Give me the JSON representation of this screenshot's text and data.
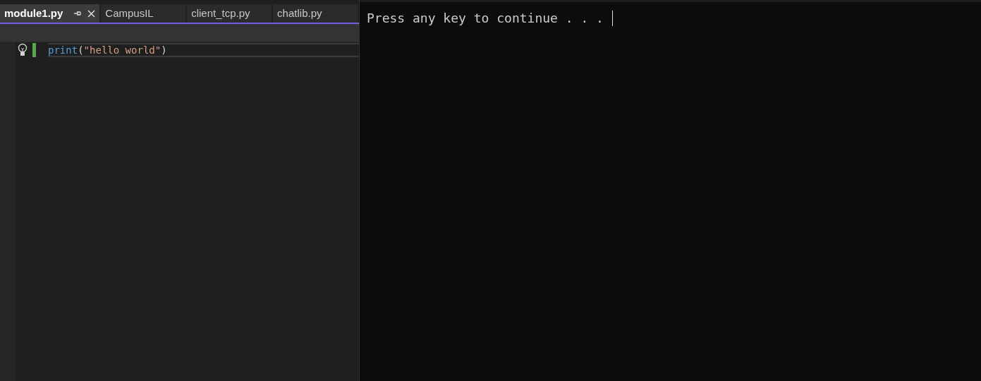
{
  "editor": {
    "tabs": [
      {
        "label": "module1.py",
        "selected": true,
        "pinned": true
      },
      {
        "label": "CampusIL",
        "selected": false,
        "pinned": false
      },
      {
        "label": "client_tcp.py",
        "selected": false,
        "pinned": false
      },
      {
        "label": "chatlib.py",
        "selected": false,
        "pinned": false
      }
    ],
    "code_line": [
      {
        "kind": "function",
        "text": "print"
      },
      {
        "kind": "punctuation",
        "text": "("
      },
      {
        "kind": "string",
        "text": "\"hello world\""
      },
      {
        "kind": "punctuation",
        "text": ")"
      }
    ]
  },
  "console": {
    "output": "Press any key to continue . . ."
  }
}
